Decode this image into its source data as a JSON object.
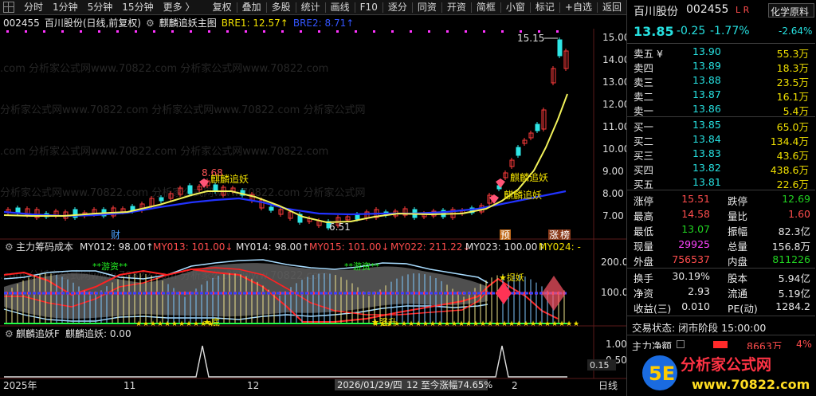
{
  "toolbar": {
    "items_left": [
      "分时",
      "1分钟",
      "5分钟",
      "15分钟",
      "更多 〉"
    ],
    "items_right": [
      "复权",
      "叠加",
      "多股",
      "统计",
      "画线",
      "F10",
      "逐分",
      "同资",
      "开资",
      "简框",
      "小窗",
      "标记",
      "+自选",
      "返回"
    ]
  },
  "info": {
    "code": "002455",
    "name": "百川股份(日线,前复权)",
    "indicator": "麒麟追妖主图",
    "bre1": "BRE1: 12.57↑",
    "bre2": "BRE2: 8.71↑"
  },
  "main_chart": {
    "price_axis": [
      "15.00",
      "14.00",
      "13.00",
      "12.00",
      "11.00",
      "10.00",
      "9.00",
      "8.00",
      "7.00"
    ],
    "high_label": "15.15",
    "label_868": "8.68",
    "label_651": "6.51",
    "signal1": "麒麟追妖",
    "signal2": "麒麟追妖",
    "signal3": "麒麟追妖",
    "marker_cai": "财",
    "marker_yu": "预",
    "marker_zhang": "涨",
    "marker_bang": "榜"
  },
  "mid_chart": {
    "title": "主力筹码成本",
    "my012": "MY012: 98.00↑",
    "my013": "MY013: 101.00↓",
    "my014": "MY014: 98.00↑",
    "my015": "MY015: 101.00↓",
    "my022": "MY022: 211.22↓",
    "my023": "MY023: 100.00↑",
    "my024": "MY024: -",
    "axis": [
      "200.0",
      "100.0"
    ],
    "youzi1": "**游资**",
    "youzi2": "**游资**",
    "zhuoyao": "★捉妖",
    "bottom1": "★底",
    "bottom2": "★强升"
  },
  "low_chart": {
    "title": "麒麟追妖F",
    "value": "麒麟追妖: 0.00",
    "axis": [
      "1.00",
      "0.50",
      "0.15"
    ]
  },
  "date_axis": {
    "year": "2025年",
    "m11": "11",
    "m12": "12",
    "cursor": "2026/01/29/四",
    "cursor_extra": "12 至今涨幅74.65%",
    "m2": "2",
    "period": "日线"
  },
  "quote": {
    "name": "百川股份",
    "code": "002455",
    "lr": "L R",
    "sector": "化学原料",
    "price": "13.85",
    "change": "-0.25",
    "pct": "-1.77%",
    "sector_pct": "-2.64%",
    "asks": [
      {
        "label": "卖五 ¥",
        "price": "13.90",
        "vol": "55.3万"
      },
      {
        "label": "卖四",
        "price": "13.89",
        "vol": "18.3万"
      },
      {
        "label": "卖三",
        "price": "13.88",
        "vol": "23.5万"
      },
      {
        "label": "卖二",
        "price": "13.87",
        "vol": "16.1万"
      },
      {
        "label": "卖一",
        "price": "13.86",
        "vol": "5.4万"
      }
    ],
    "bids": [
      {
        "label": "买一",
        "price": "13.85",
        "vol": "65.0万"
      },
      {
        "label": "买二",
        "price": "13.84",
        "vol": "134.4万"
      },
      {
        "label": "买三",
        "price": "13.83",
        "vol": "43.6万"
      },
      {
        "label": "买四",
        "price": "13.82",
        "vol": "438.6万"
      },
      {
        "label": "买五",
        "price": "13.81",
        "vol": "22.6万"
      }
    ],
    "stats": [
      {
        "l1": "涨停",
        "v1": "15.51",
        "c1": "red",
        "l2": "跌停",
        "v2": "12.69",
        "c2": "green"
      },
      {
        "l1": "最高",
        "v1": "14.58",
        "c1": "red",
        "l2": "量比",
        "v2": "1.60",
        "c2": "red"
      },
      {
        "l1": "最低",
        "v1": "13.07",
        "c1": "green",
        "l2": "振幅",
        "v2": "82.3亿",
        "c2": "white"
      },
      {
        "l1": "现量",
        "v1": "29925",
        "c1": "magenta",
        "l2": "总量",
        "v2": "156.8万",
        "c2": "white"
      },
      {
        "l1": "外盘",
        "v1": "756537",
        "c1": "red",
        "l2": "内盘",
        "v2": "811226",
        "c2": "green"
      }
    ],
    "stats2": [
      {
        "l1": "换手",
        "v1": "30.19%",
        "l2": "股本",
        "v2": "5.94亿"
      },
      {
        "l1": "净资",
        "v1": "2.93",
        "l2": "流通",
        "v2": "5.19亿"
      },
      {
        "l1": "收益(三)",
        "v1": "0.010",
        "l2": "PE(动)",
        "v2": "1284.2"
      }
    ],
    "status": "交易状态: 闭市阶段 15:00:00",
    "netflow_label": "主力净额",
    "netflow_value": "8663万",
    "netflow_pct": "4%"
  },
  "logo": {
    "text": "分析家公式网",
    "url": "www.70822.com"
  },
  "watermarks": [
    ".com 分析家公式网www.70822.com 分析家公式网www.70822.com",
    "分析家公式网www.70822.com 分析家公式网www.70822.com 分析家公式网",
    ".com 分析家公式网www.70822.com 分析家公式网www.70822.com",
    "分析家公式网www.70822.com 分析家公式网www.70822.com 分析家公式网",
    ".com 分析家公式网www.70822.com 分析家公式网www.70822.com"
  ]
}
